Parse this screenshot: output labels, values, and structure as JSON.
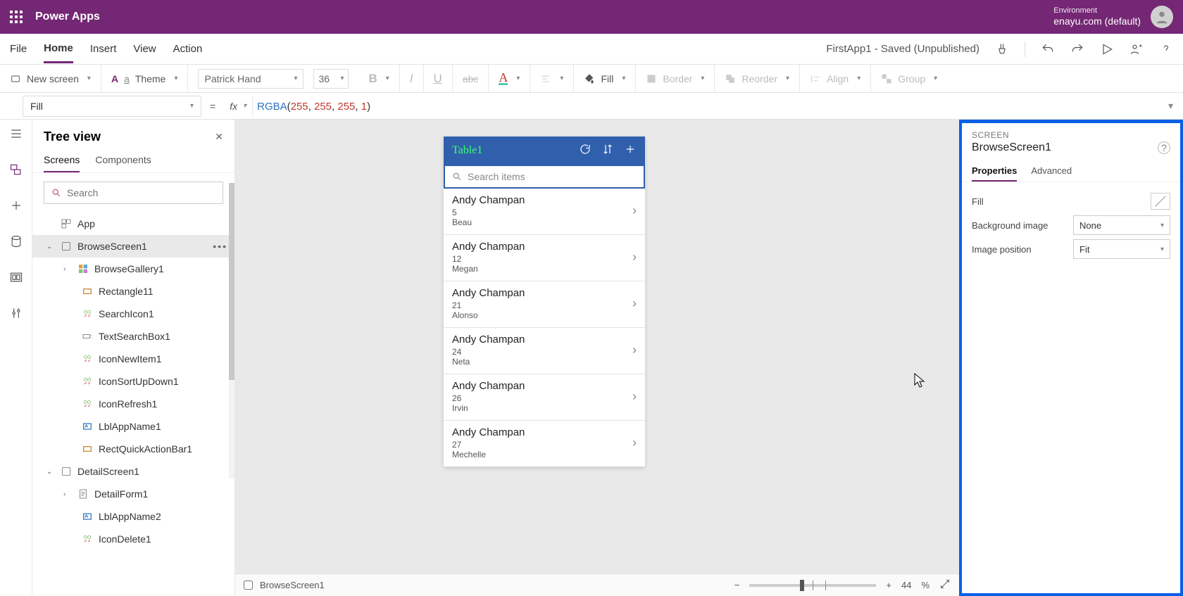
{
  "app": {
    "name": "Power Apps"
  },
  "environment": {
    "label": "Environment",
    "name": "enayu.com (default)"
  },
  "fileStatus": "FirstApp1 - Saved (Unpublished)",
  "menu": {
    "file": "File",
    "home": "Home",
    "insert": "Insert",
    "view": "View",
    "action": "Action"
  },
  "ribbon": {
    "newScreen": "New screen",
    "theme": "Theme",
    "font": "Patrick Hand",
    "size": "36",
    "fill": "Fill",
    "border": "Border",
    "reorder": "Reorder",
    "align": "Align",
    "group": "Group"
  },
  "formula": {
    "property": "Fill",
    "fn": "RGBA",
    "args": [
      "255",
      "255",
      "255",
      "1"
    ]
  },
  "tree": {
    "title": "Tree view",
    "tabs": {
      "screens": "Screens",
      "components": "Components"
    },
    "searchPlaceholder": "Search",
    "app": "App",
    "browseScreen": "BrowseScreen1",
    "browseGallery": "BrowseGallery1",
    "rectangle11": "Rectangle11",
    "searchIcon1": "SearchIcon1",
    "textSearchBox1": "TextSearchBox1",
    "iconNewItem1": "IconNewItem1",
    "iconSortUpDown1": "IconSortUpDown1",
    "iconRefresh1": "IconRefresh1",
    "lblAppName1": "LblAppName1",
    "rectQuickActionBar1": "RectQuickActionBar1",
    "detailScreen1": "DetailScreen1",
    "detailForm1": "DetailForm1",
    "lblAppName2": "LblAppName2",
    "iconDelete1": "IconDelete1"
  },
  "canvas": {
    "appTitle": "Table1",
    "searchPlaceholder": "Search items",
    "items": [
      {
        "title": "Andy Champan",
        "sub1": "5",
        "sub2": "Beau"
      },
      {
        "title": "Andy Champan",
        "sub1": "12",
        "sub2": "Megan"
      },
      {
        "title": "Andy Champan",
        "sub1": "21",
        "sub2": "Alonso"
      },
      {
        "title": "Andy Champan",
        "sub1": "24",
        "sub2": "Neta"
      },
      {
        "title": "Andy Champan",
        "sub1": "26",
        "sub2": "Irvin"
      },
      {
        "title": "Andy Champan",
        "sub1": "27",
        "sub2": "Mechelle"
      }
    ]
  },
  "status": {
    "screenName": "BrowseScreen1",
    "zoom": "44",
    "pct": "%"
  },
  "props": {
    "typeLabel": "SCREEN",
    "name": "BrowseScreen1",
    "tabs": {
      "properties": "Properties",
      "advanced": "Advanced"
    },
    "fillLabel": "Fill",
    "bgImageLabel": "Background image",
    "bgImageValue": "None",
    "imgPosLabel": "Image position",
    "imgPosValue": "Fit"
  }
}
